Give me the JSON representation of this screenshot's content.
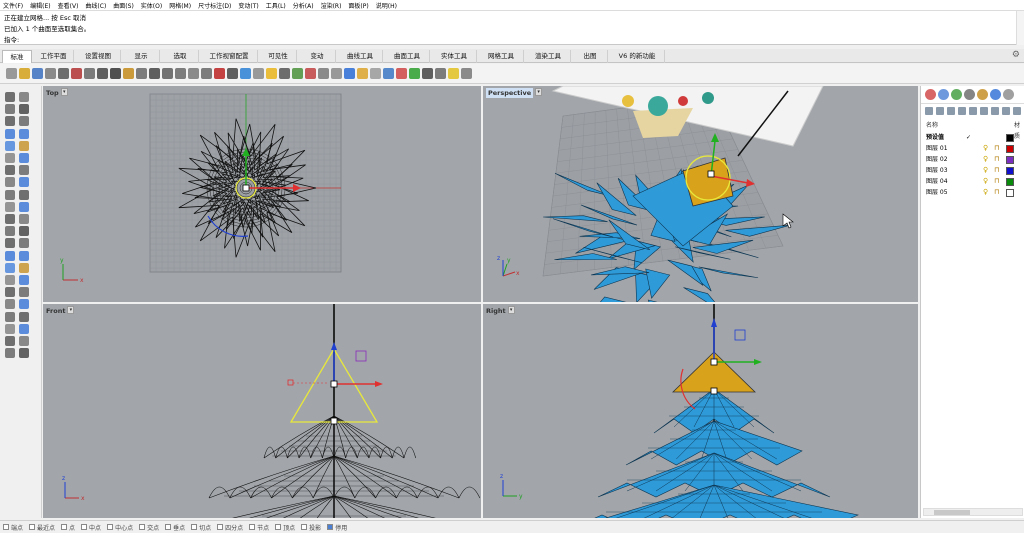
{
  "menu": [
    "文件(F)",
    "编辑(E)",
    "查看(V)",
    "曲线(C)",
    "曲面(S)",
    "实体(O)",
    "网格(M)",
    "尺寸标注(D)",
    "变动(T)",
    "工具(L)",
    "分析(A)",
    "渲染(R)",
    "面板(P)",
    "说明(H)"
  ],
  "command": {
    "line1": "正在建立网格... 按 Esc 取消",
    "line2": "已加入 1 个曲面至选取集合。",
    "prompt": "指令:"
  },
  "tabs": [
    "标准",
    "工作平面",
    "设置视图",
    "显示",
    "选取",
    "工作视窗配置",
    "可见性",
    "变动",
    "曲线工具",
    "曲面工具",
    "实体工具",
    "网格工具",
    "渲染工具",
    "出图",
    "V6 的新功能"
  ],
  "viewports": {
    "top": "Top",
    "perspective": "Perspective",
    "front": "Front",
    "right": "Right"
  },
  "axes": {
    "x": "x",
    "y": "y",
    "z": "z"
  },
  "layers": {
    "header_name": "名称",
    "header_material": "材质",
    "rows": [
      {
        "name": "预设值",
        "current": "✓",
        "color": "#000000"
      },
      {
        "name": "图层 01",
        "color": "#cc0000"
      },
      {
        "name": "图层 02",
        "color": "#7b2fbf"
      },
      {
        "name": "图层 03",
        "color": "#1010cc"
      },
      {
        "name": "图层 04",
        "color": "#0a8a0a"
      },
      {
        "name": "图层 05",
        "color": "#ffffff"
      }
    ]
  },
  "snaps": [
    "端点",
    "最近点",
    "点",
    "中点",
    "中心点",
    "交点",
    "垂点",
    "切点",
    "四分点",
    "节点",
    "顶点",
    "投影",
    "停用"
  ],
  "colors": {
    "tree": "#2f9ad8",
    "cone": "#d9a21b",
    "viewport": "#a2a6ab"
  }
}
